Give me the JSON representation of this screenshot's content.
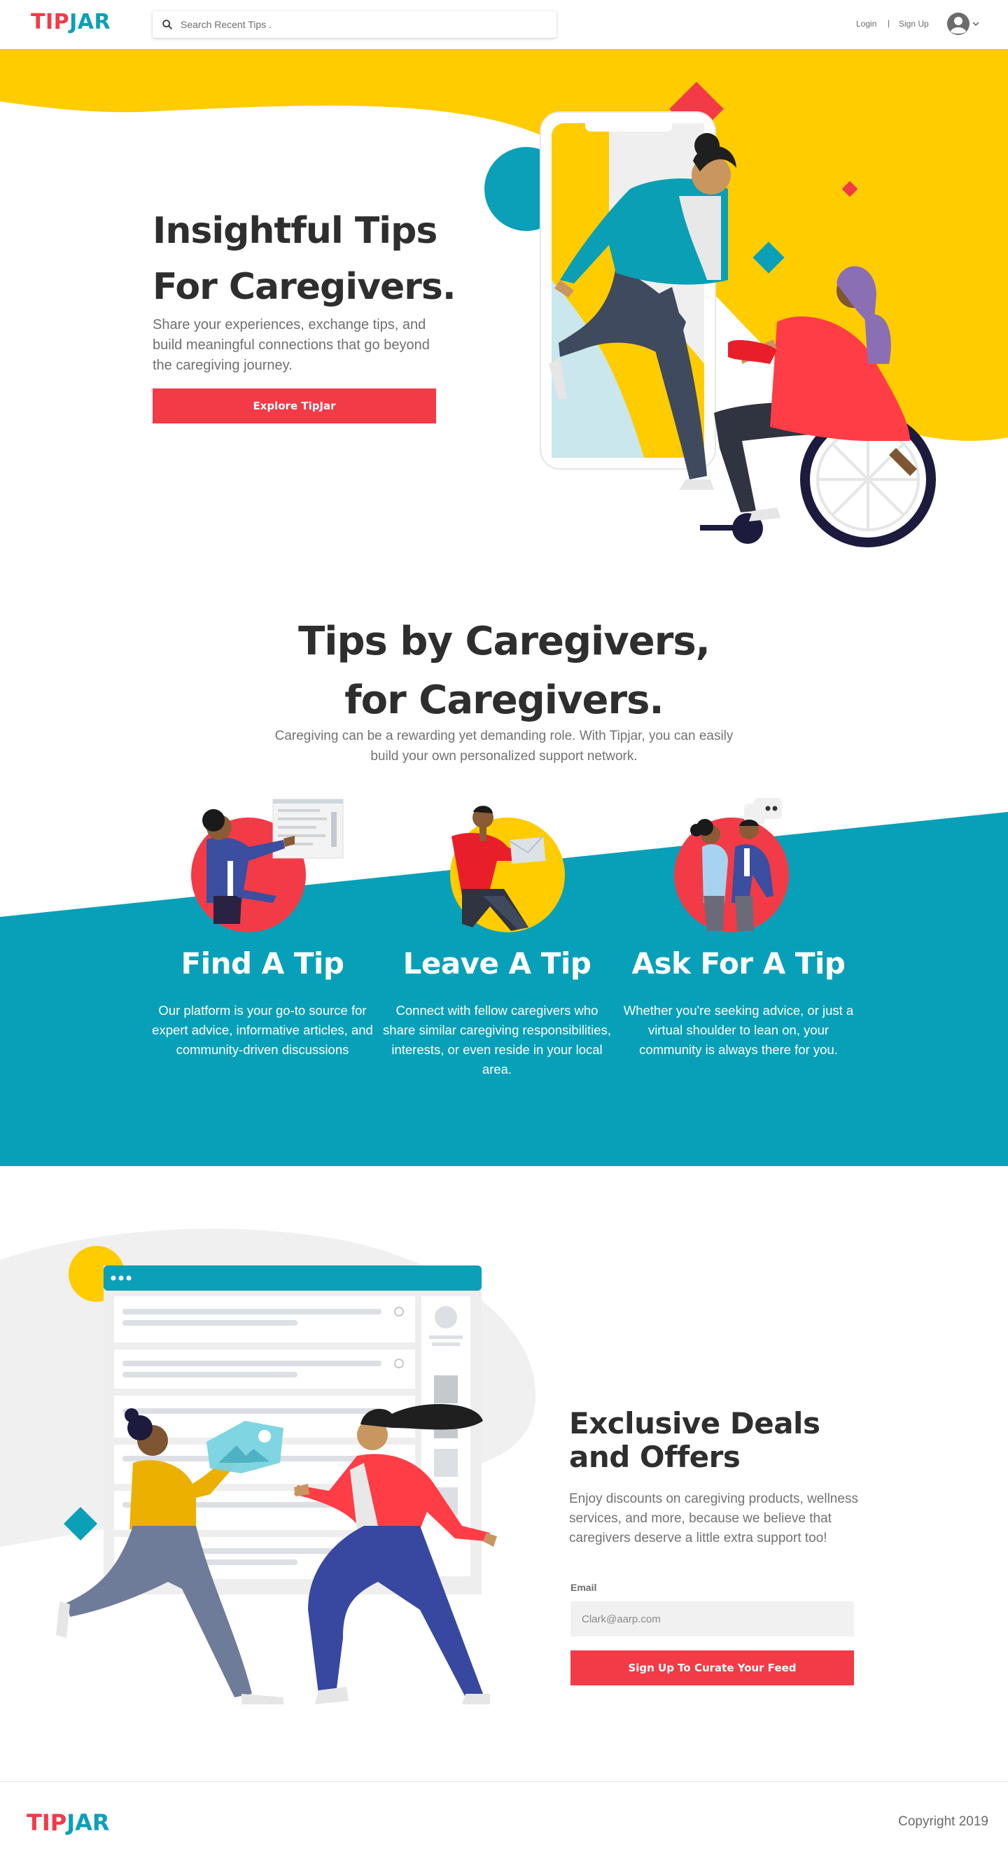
{
  "header": {
    "logo_tip": "TIP",
    "logo_jar": "JAR",
    "search_placeholder": "Search Recent Tips .",
    "login": "Login",
    "separator": "|",
    "signup": "Sign Up"
  },
  "hero": {
    "title_line1": "Insightful Tips",
    "title_line2": "For Caregivers.",
    "subtitle": "Share your experiences, exchange tips, and build meaningful connections that go beyond the caregiving journey.",
    "button": "Explore TipJar"
  },
  "tips": {
    "title_line1": "Tips by Caregivers,",
    "title_line2": "for Caregivers.",
    "subtitle": "Caregiving can be a rewarding yet demanding role. With Tipjar, you can easily build your own personalized support network.",
    "features": [
      {
        "title": "Find A Tip",
        "text": "Our platform is your go-to source for expert advice, informative articles, and community-driven discussions"
      },
      {
        "title": "Leave A Tip",
        "text": "Connect with fellow caregivers who share similar caregiving responsibilities, interests, or even reside in your local area."
      },
      {
        "title": "Ask For A Tip",
        "text": "Whether you're seeking advice, or just a virtual shoulder to lean on, your community is always there for you."
      }
    ]
  },
  "deals": {
    "title": "Exclusive Deals and Offers",
    "subtitle": "Enjoy discounts on caregiving products, wellness services, and more, because we believe that caregivers deserve a little extra support too!",
    "email_label": "Email",
    "email_placeholder": "Clark@aarp.com",
    "button": "Sign Up To Curate Your Feed"
  },
  "footer": {
    "logo_tip": "TIP",
    "logo_jar": "JAR",
    "copyright": "Copyright 2019"
  },
  "colors": {
    "brand_red": "#f23b47",
    "brand_teal": "#0aa0b8",
    "hero_yellow": "#ffcc00"
  },
  "icons": [
    "search-icon",
    "user-avatar-icon",
    "chevron-down-icon"
  ]
}
